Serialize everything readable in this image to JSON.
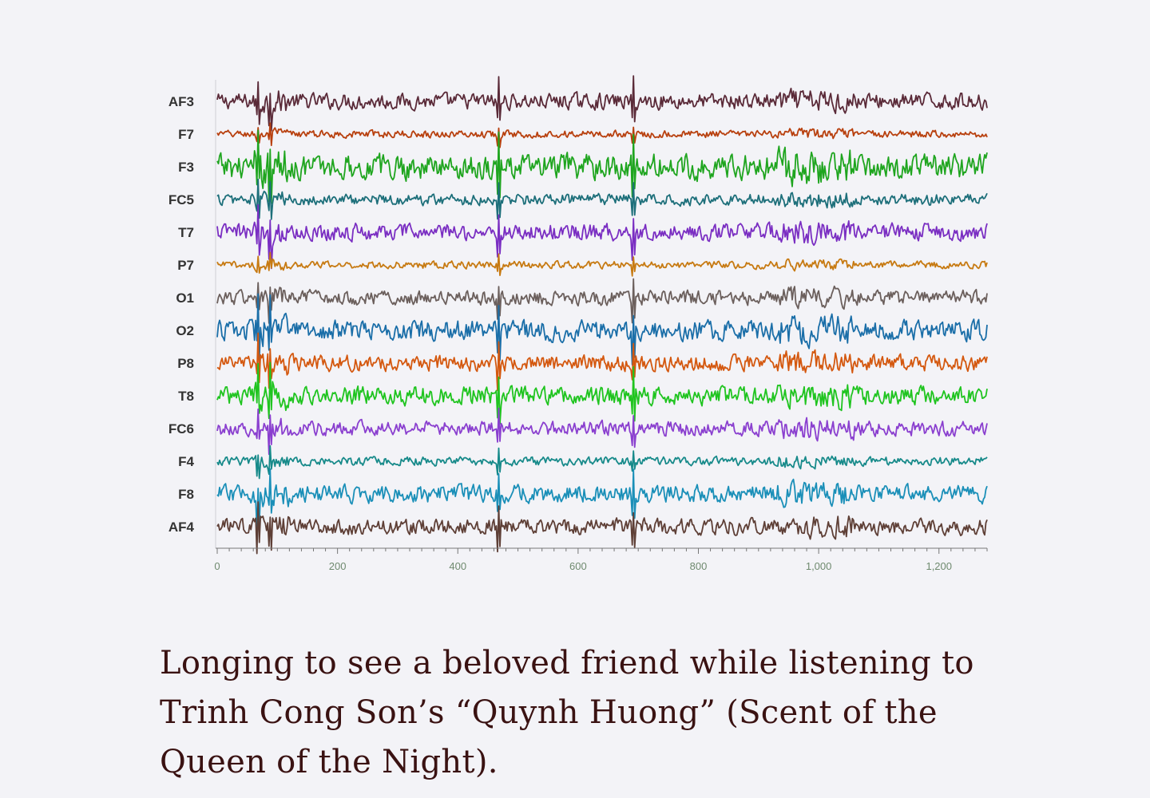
{
  "chart_data": {
    "type": "line",
    "title": "",
    "xlabel": "",
    "ylabel": "",
    "xlim": [
      0,
      1280
    ],
    "x_ticks": [
      "0",
      "200",
      "400",
      "600",
      "800",
      "1,000",
      "1,200"
    ],
    "x_tick_values": [
      0,
      200,
      400,
      600,
      800,
      1000,
      1200
    ],
    "grid": false,
    "legend": "none",
    "series": [
      {
        "name": "AF3",
        "color": "#5a2a38",
        "amplitude": 0.55
      },
      {
        "name": "F7",
        "color": "#b8400e",
        "amplitude": 0.25
      },
      {
        "name": "F3",
        "color": "#1fa51f",
        "amplitude": 0.9
      },
      {
        "name": "FC5",
        "color": "#1d6f7a",
        "amplitude": 0.4
      },
      {
        "name": "T7",
        "color": "#7a2ec2",
        "amplitude": 0.6
      },
      {
        "name": "P7",
        "color": "#c77a12",
        "amplitude": 0.25
      },
      {
        "name": "O1",
        "color": "#6b5f5c",
        "amplitude": 0.5
      },
      {
        "name": "O2",
        "color": "#1a6ea8",
        "amplitude": 0.7
      },
      {
        "name": "P8",
        "color": "#d4580f",
        "amplitude": 0.55
      },
      {
        "name": "T8",
        "color": "#1fc41f",
        "amplitude": 0.65
      },
      {
        "name": "FC6",
        "color": "#8a3fcf",
        "amplitude": 0.5
      },
      {
        "name": "F4",
        "color": "#178a8a",
        "amplitude": 0.3
      },
      {
        "name": "F8",
        "color": "#1a8fb8",
        "amplitude": 0.6
      },
      {
        "name": "AF4",
        "color": "#5e3f36",
        "amplitude": 0.55
      }
    ],
    "spike_times": [
      68,
      88,
      468,
      692
    ]
  },
  "caption": "Longing to see a beloved friend while listening to Trinh Cong Son’s “Quynh Huong” (Scent of the Queen of the Night).",
  "colors": {
    "background": "#f3f3f7",
    "caption_text": "#3a1212",
    "axis": "#777777",
    "tick_text": "#6f8a6f"
  }
}
